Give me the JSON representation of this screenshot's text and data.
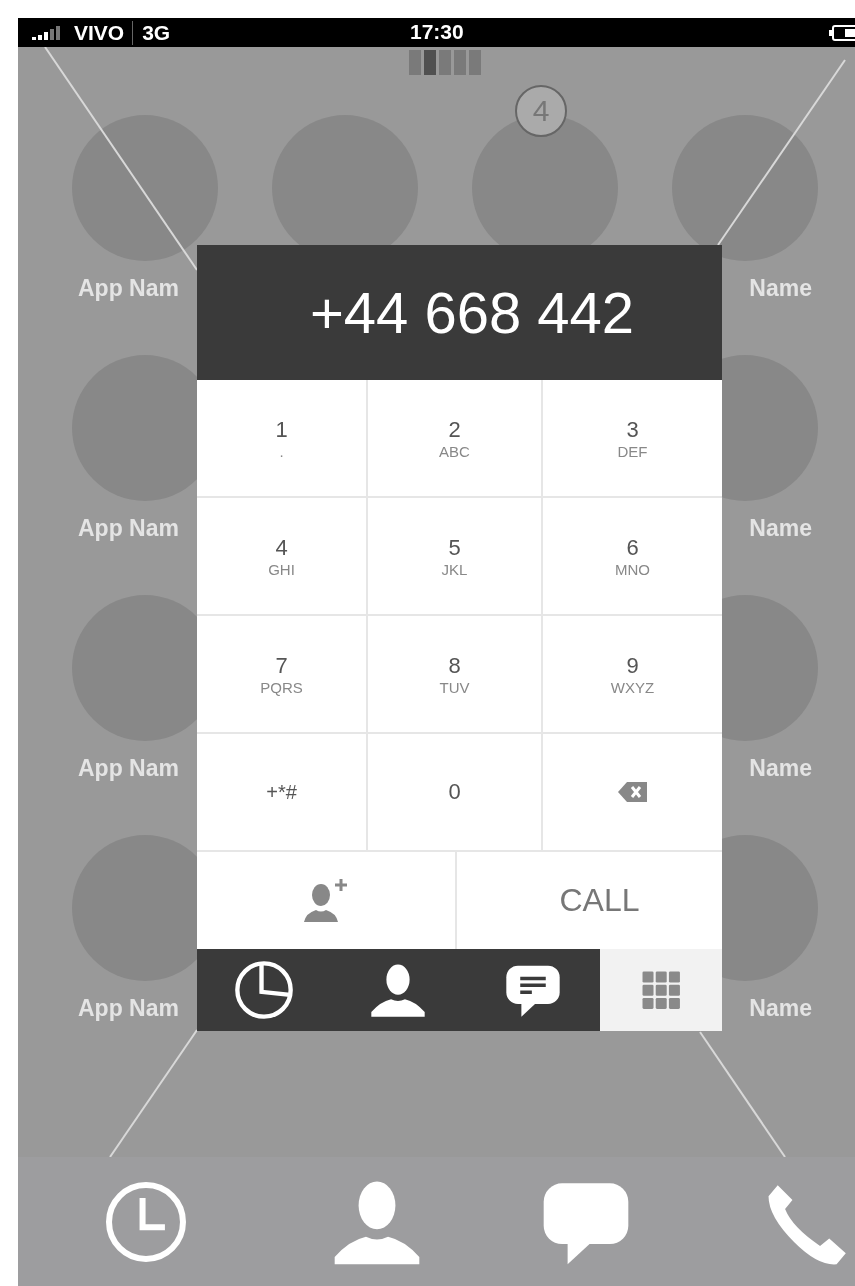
{
  "status_bar": {
    "carrier": "VIVO",
    "network": "3G",
    "time": "17:30"
  },
  "home": {
    "pages": [
      {
        "selected": false
      },
      {
        "selected": true
      },
      {
        "selected": false
      },
      {
        "selected": false
      },
      {
        "selected": false
      }
    ],
    "badge": "4",
    "app_rows": [
      {
        "left_label": "App Nam",
        "right_label": "Name"
      },
      {
        "left_label": "App Nam",
        "right_label": "Name"
      },
      {
        "left_label": "App Nam",
        "right_label": "Name"
      },
      {
        "left_label": "App Nam",
        "right_label": "Name"
      }
    ]
  },
  "dialer": {
    "number": "+44 668 442",
    "keys": [
      {
        "kind": "digit",
        "digit": "1",
        "letters": "."
      },
      {
        "kind": "digit",
        "digit": "2",
        "letters": "ABC"
      },
      {
        "kind": "digit",
        "digit": "3",
        "letters": "DEF"
      },
      {
        "kind": "digit",
        "digit": "4",
        "letters": "GHI"
      },
      {
        "kind": "digit",
        "digit": "5",
        "letters": "JKL"
      },
      {
        "kind": "digit",
        "digit": "6",
        "letters": "MNO"
      },
      {
        "kind": "digit",
        "digit": "7",
        "letters": "PQRS"
      },
      {
        "kind": "digit",
        "digit": "8",
        "letters": "TUV"
      },
      {
        "kind": "digit",
        "digit": "9",
        "letters": "WXYZ"
      },
      {
        "kind": "symbol",
        "digit": "+*#"
      },
      {
        "kind": "digit",
        "digit": "0"
      },
      {
        "kind": "backspace"
      }
    ],
    "call_label": "CALL",
    "tabs": [
      {
        "kind": "recent",
        "selected": false
      },
      {
        "kind": "contacts",
        "selected": false
      },
      {
        "kind": "messages",
        "selected": false
      },
      {
        "kind": "keypad",
        "selected": true
      }
    ]
  },
  "dock": [
    {
      "kind": "clock"
    },
    {
      "kind": "contacts"
    },
    {
      "kind": "messages"
    },
    {
      "kind": "phone"
    }
  ]
}
